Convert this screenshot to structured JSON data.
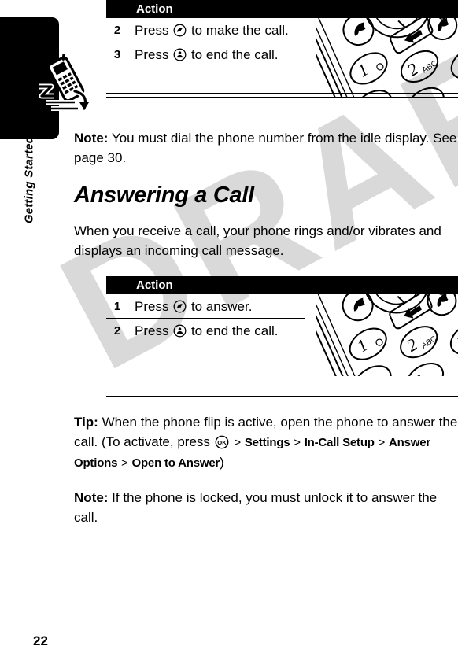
{
  "page": {
    "number": "22",
    "chapter_label": "Getting Started",
    "watermark_text": "DRAFT"
  },
  "tables": [
    {
      "header": "Action",
      "rows": [
        {
          "num": "2",
          "text_before": "Press",
          "key_icon": "send-key-icon",
          "text_after": "to make the call."
        },
        {
          "num": "3",
          "text_before": "Press",
          "key_icon": "end-key-icon",
          "text_after": "to end the call."
        }
      ],
      "illustration": "phone-keypad-illustration"
    },
    {
      "header": "Action",
      "rows": [
        {
          "num": "1",
          "text_before": "Press",
          "key_icon": "send-key-icon",
          "text_after": "to answer."
        },
        {
          "num": "2",
          "text_before": "Press",
          "key_icon": "end-key-icon",
          "text_after": "to end the call."
        }
      ],
      "illustration": "phone-keypad-illustration"
    }
  ],
  "notes": {
    "note1_label": "Note:",
    "note1_text": " You must dial the phone number from the idle display. See page 30.",
    "note2_label": "Note:",
    "note2_text": " If the phone is locked, you must unlock it to answer the call."
  },
  "section": {
    "heading": "Answering a Call",
    "intro": "When you receive a call, your phone rings and/or vibrates and displays an incoming call message."
  },
  "tip": {
    "label": "Tip:",
    "text_part1": " When the phone flip is active, open the phone to answer the call. (To activate, press",
    "menu_path": [
      "Settings",
      "In-Call Setup",
      "Answer Options",
      "Open to Answer"
    ],
    "separator": ">",
    "closing": ")"
  },
  "colors": {
    "ink": "#000000",
    "paper": "#ffffff",
    "watermark": "#d9d9d9",
    "header_bar": "#000000"
  }
}
